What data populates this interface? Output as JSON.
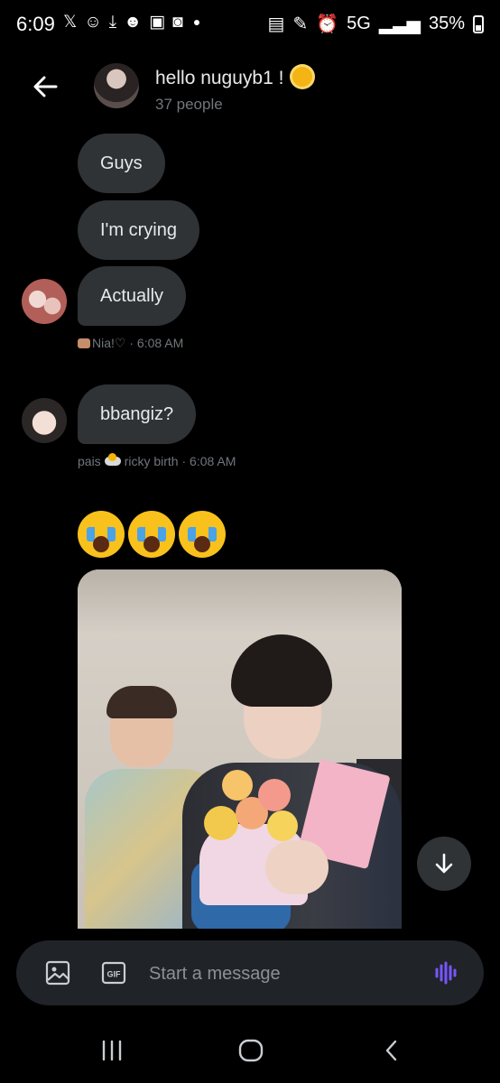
{
  "status_bar": {
    "time": "6:09",
    "network": "5G",
    "battery": "35%"
  },
  "header": {
    "group_name": "hello nuguyb1 !",
    "member_count": "37 people"
  },
  "messages": [
    {
      "text": "Guys"
    },
    {
      "text": "I'm crying"
    },
    {
      "text": "Actually"
    },
    {
      "text": "bbangiz?"
    }
  ],
  "meta": {
    "first": {
      "sender": "Nia!♡",
      "time": "6:08 AM"
    },
    "second": {
      "sender_a": "pais",
      "sender_b": "ricky birth",
      "time": "6:08 AM"
    }
  },
  "emoji_row": {
    "count": 3,
    "icon": "loudly-crying-face"
  },
  "composer": {
    "placeholder": "Start a message",
    "gif_label": "GIF"
  },
  "colors": {
    "background": "#000000",
    "bubble": "#2f3336",
    "muted_text": "#71767b",
    "accent_audio": "#7856ff"
  }
}
